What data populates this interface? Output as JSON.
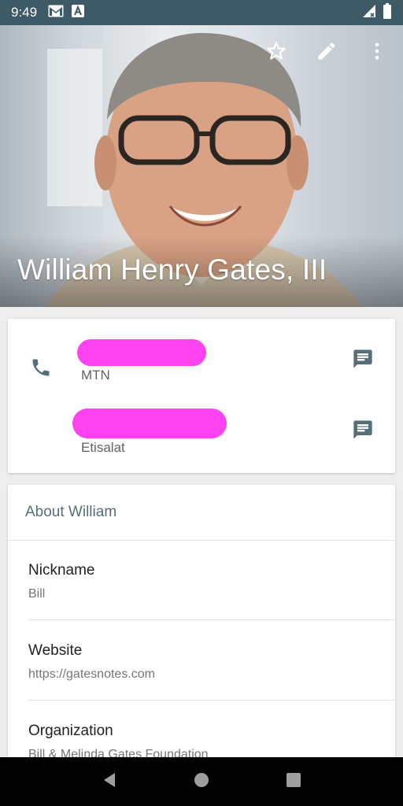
{
  "status_bar": {
    "time": "9:49",
    "icons": [
      "gmail-icon",
      "text-a-icon",
      "signal-icon",
      "battery-icon"
    ]
  },
  "header": {
    "name": "William Henry Gates, III",
    "actions": [
      "star-outline-icon",
      "pencil-icon",
      "more-vert-icon"
    ]
  },
  "phones": [
    {
      "number": "",
      "label": "MTN",
      "icon": "phone-icon",
      "action_icon": "message-icon"
    },
    {
      "number": "",
      "label": "Etisalat",
      "action_icon": "message-icon"
    }
  ],
  "about": {
    "title": "About William",
    "fields": [
      {
        "label": "Nickname",
        "value": "Bill"
      },
      {
        "label": "Website",
        "value": "https://gatesnotes.com"
      },
      {
        "label": "Organization",
        "value": "Bill & Melinda Gates Foundation"
      }
    ]
  },
  "colors": {
    "status_bar": "#3e5a66",
    "accent": "#546e7a",
    "redaction": "#ff43f0"
  }
}
